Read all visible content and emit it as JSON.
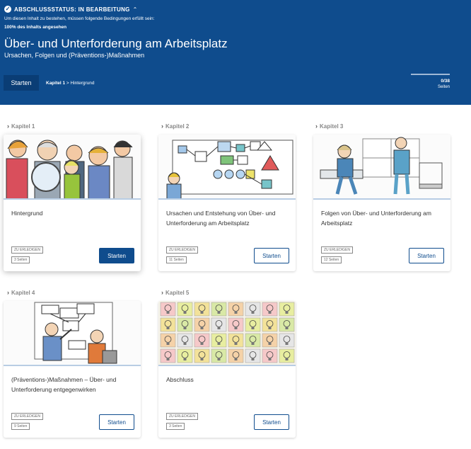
{
  "header": {
    "status_label": "ABSCHLUSSSTATUS: IN BEARBEITUNG",
    "condition_intro": "Um diesen Inhalt zu bestehen, müssen folgende Bedingungen erfüllt sein:",
    "condition_requirement": "100% des Inhalts angesehen",
    "title": "Über- und Unterforderung am Arbeitsplatz",
    "subtitle": "Ursachen, Folgen und (Präventions-)Maßnahmen",
    "start_label": "Starten",
    "breadcrumb_chapter": "Kapitel 1",
    "breadcrumb_sep": " > ",
    "breadcrumb_page": "Hintergrund",
    "progress_text": "0/38",
    "progress_unit": "Seiten",
    "progress_fraction": 0
  },
  "chapters": [
    {
      "label": "Kapitel 1",
      "title": "Hintergrund",
      "tag": "ZU ERLEDIGEN",
      "pages": "3 Seiten",
      "button": "Starten"
    },
    {
      "label": "Kapitel 2",
      "title": "Ursachen und Entstehung von Über- und Unterforderung am Arbeitsplatz",
      "tag": "ZU ERLEDIGEN",
      "pages": "11 Seiten",
      "button": "Starten"
    },
    {
      "label": "Kapitel 3",
      "title": "Folgen von Über- und Unterforderung am Arbeitsplatz",
      "tag": "ZU ERLEDIGEN",
      "pages": "12 Seiten",
      "button": "Starten"
    },
    {
      "label": "Kapitel 4",
      "title": "(Präventions-)Maßnahmen – Über- und Unterforderung entgegenwirken",
      "tag": "ZU ERLEDIGEN",
      "pages": "9 Seiten",
      "button": "Starten"
    },
    {
      "label": "Kapitel 5",
      "title": "Abschluss",
      "tag": "ZU ERLEDIGEN",
      "pages": "3 Seiten",
      "button": "Starten"
    }
  ],
  "icons": {
    "status": "check-circle-icon",
    "collapse": "chevron-up-icon",
    "chapter": "chevron-right-icon"
  },
  "colors": {
    "header_bg": "#0f4c8d",
    "accent": "#0f4c8d"
  }
}
